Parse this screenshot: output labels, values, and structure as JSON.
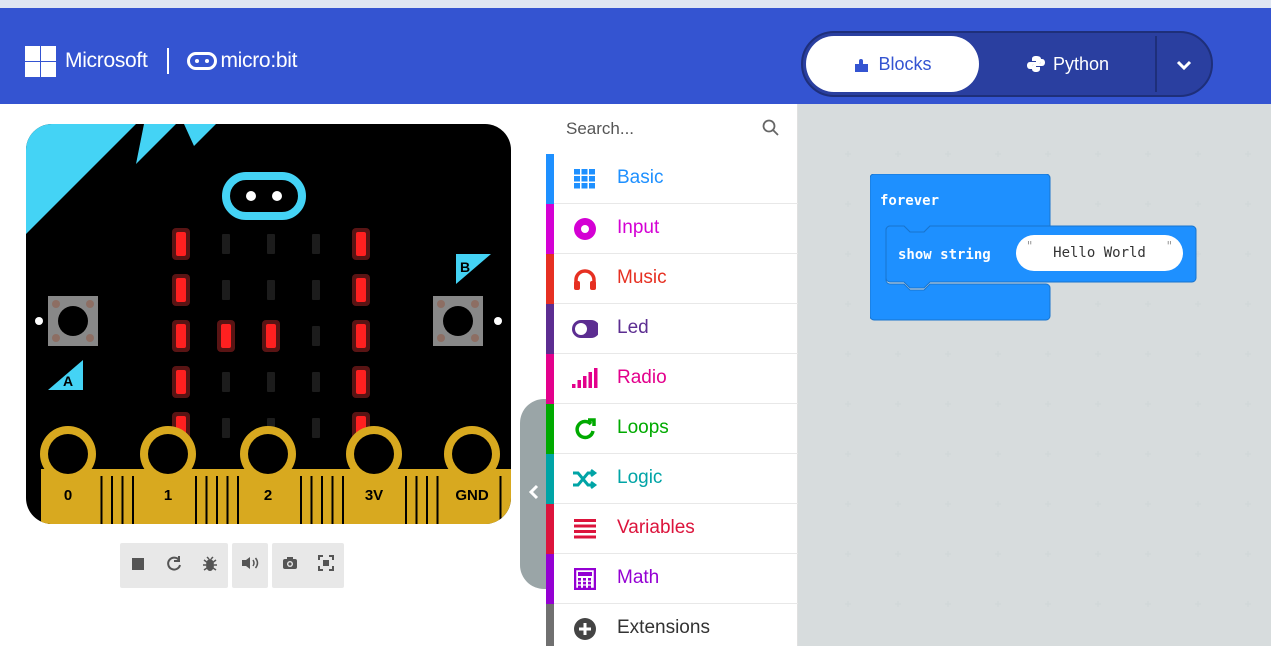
{
  "header": {
    "brand_microsoft": "Microsoft",
    "brand_microbit": "micro:bit",
    "tab_blocks": "Blocks",
    "tab_python": "Python",
    "bg_color": "#3454d1"
  },
  "simulator": {
    "button_a": "A",
    "button_b": "B",
    "pins": [
      "0",
      "1",
      "2",
      "3V",
      "GND"
    ],
    "leds_on": [
      [
        1,
        0,
        0,
        0,
        1
      ],
      [
        1,
        0,
        0,
        0,
        1
      ],
      [
        1,
        1,
        1,
        0,
        1
      ],
      [
        1,
        0,
        0,
        0,
        1
      ],
      [
        1,
        0,
        0,
        0,
        1
      ]
    ],
    "toolbar_icons": [
      "stop-icon",
      "restart-icon",
      "debug-icon",
      "mute-icon",
      "screenshot-icon",
      "fullscreen-icon"
    ]
  },
  "toolbox": {
    "search_placeholder": "Search...",
    "categories": [
      {
        "label": "Basic",
        "color": "#1e90ff",
        "icon": "grid-icon"
      },
      {
        "label": "Input",
        "color": "#d400d4",
        "icon": "circle-dot-icon"
      },
      {
        "label": "Music",
        "color": "#e63022",
        "icon": "headphones-icon"
      },
      {
        "label": "Led",
        "color": "#5c2d91",
        "icon": "toggle-icon"
      },
      {
        "label": "Radio",
        "color": "#e3008c",
        "icon": "signal-bars-icon"
      },
      {
        "label": "Loops",
        "color": "#00aa00",
        "icon": "loop-arrow-icon"
      },
      {
        "label": "Logic",
        "color": "#00a4a6",
        "icon": "shuffle-icon"
      },
      {
        "label": "Variables",
        "color": "#dc143c",
        "icon": "list-icon"
      },
      {
        "label": "Math",
        "color": "#9400d3",
        "icon": "calculator-icon"
      },
      {
        "label": "Extensions",
        "color": "#707070",
        "icon": "plus-circle-icon"
      }
    ]
  },
  "workspace": {
    "forever_label": "forever",
    "show_string_label": "show string",
    "string_value": "Hello World",
    "block_color": "#1e90ff"
  }
}
